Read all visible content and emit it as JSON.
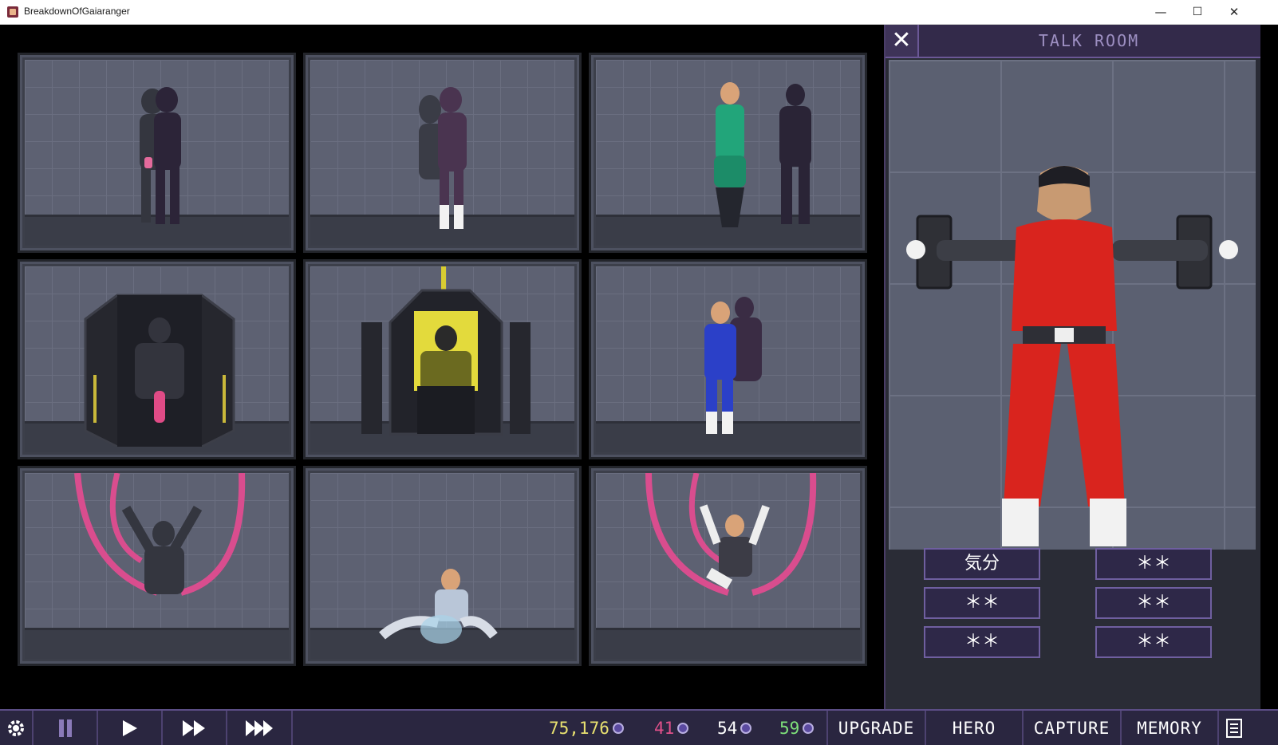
{
  "window": {
    "title": "BreakdownOfGaiaranger",
    "minimize": "—",
    "maximize": "☐",
    "close": "✕"
  },
  "talk_room": {
    "title": "TALK ROOM",
    "close_label": "✕",
    "choices": [
      "気分",
      "＊＊",
      "＊＊",
      "＊＊",
      "＊＊",
      "＊＊"
    ]
  },
  "bottom_bar": {
    "settings_icon": "gear-icon",
    "pause_icon": "pause-icon",
    "play_icon": "play-icon",
    "fast_icon": "fast-forward-icon",
    "faster_icon": "fastest-forward-icon",
    "stats": [
      {
        "value": "75,176",
        "color": "#e8e070"
      },
      {
        "value": "41",
        "color": "#e0508a"
      },
      {
        "value": "54",
        "color": "#ffffff"
      },
      {
        "value": "59",
        "color": "#7ee07a"
      }
    ],
    "menu": [
      "UPGRADE",
      "HERO",
      "CAPTURE",
      "MEMORY"
    ],
    "log_icon": "log-icon"
  },
  "colors": {
    "accent": "#6b5896",
    "panel_title": "#9d8fc2"
  }
}
